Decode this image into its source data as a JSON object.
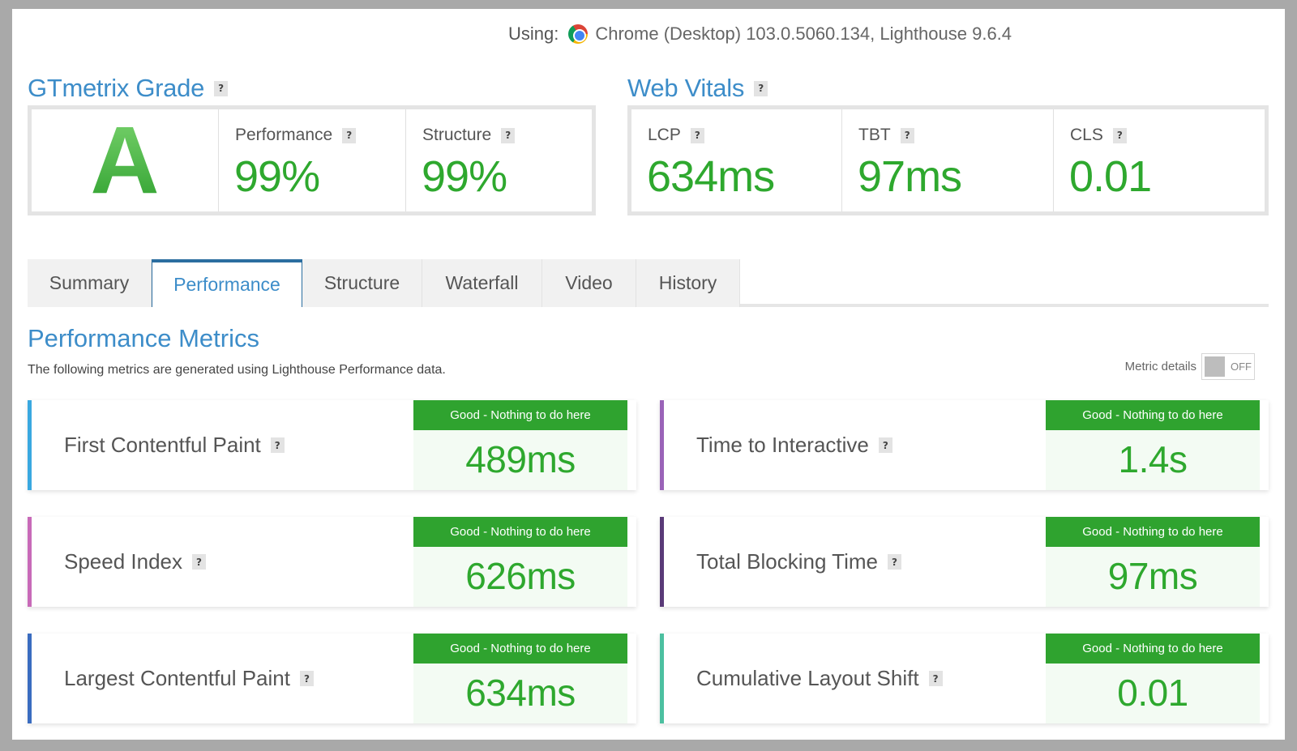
{
  "header": {
    "using_label": "Using:",
    "browser_info": "Chrome (Desktop) 103.0.5060.134, Lighthouse 9.6.4",
    "browser_icon": "chrome-icon"
  },
  "grade": {
    "title": "GTmetrix Grade",
    "letter": "A",
    "performance_label": "Performance",
    "performance_value": "99%",
    "structure_label": "Structure",
    "structure_value": "99%"
  },
  "web_vitals": {
    "title": "Web Vitals",
    "lcp_label": "LCP",
    "lcp_value": "634ms",
    "tbt_label": "TBT",
    "tbt_value": "97ms",
    "cls_label": "CLS",
    "cls_value": "0.01"
  },
  "tabs": [
    {
      "label": "Summary"
    },
    {
      "label": "Performance",
      "active": true
    },
    {
      "label": "Structure"
    },
    {
      "label": "Waterfall"
    },
    {
      "label": "Video"
    },
    {
      "label": "History"
    }
  ],
  "performance_metrics": {
    "title": "Performance Metrics",
    "description": "The following metrics are generated using Lighthouse Performance data.",
    "metric_details_label": "Metric details",
    "toggle_state": "OFF"
  },
  "help_glyph": "?",
  "metrics": [
    {
      "name": "First Contentful Paint",
      "status": "Good - Nothing to do here",
      "value": "489ms",
      "color": "#3aa8e0"
    },
    {
      "name": "Time to Interactive",
      "status": "Good - Nothing to do here",
      "value": "1.4s",
      "color": "#9a63b8"
    },
    {
      "name": "Speed Index",
      "status": "Good - Nothing to do here",
      "value": "626ms",
      "color": "#c86ab8"
    },
    {
      "name": "Total Blocking Time",
      "status": "Good - Nothing to do here",
      "value": "97ms",
      "color": "#5a3a78"
    },
    {
      "name": "Largest Contentful Paint",
      "status": "Good - Nothing to do here",
      "value": "634ms",
      "color": "#3a6cc0"
    },
    {
      "name": "Cumulative Layout Shift",
      "status": "Good - Nothing to do here",
      "value": "0.01",
      "color": "#4cc0a0"
    }
  ],
  "colors": {
    "accent_blue": "#3d8dc9",
    "good_green": "#2fa32f",
    "value_green": "#2ea82e"
  }
}
